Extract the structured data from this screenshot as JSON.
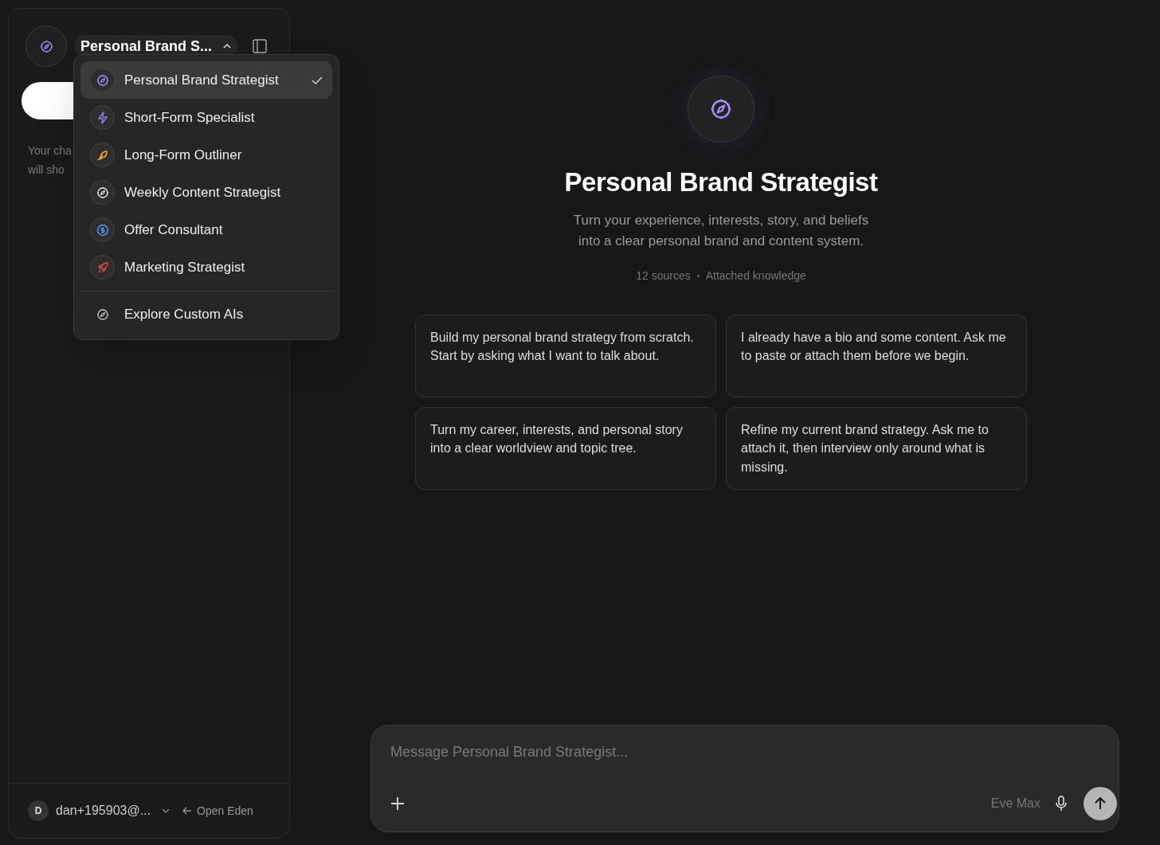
{
  "sidebar": {
    "assistant_button": {
      "title": "Personal Brand S...",
      "expanded": true
    },
    "empty_hint": [
      "Your cha",
      "will sho"
    ],
    "account": {
      "initial": "D",
      "email": "dan+195903@...",
      "action": "Open Eden"
    }
  },
  "assistant_menu": {
    "items": [
      {
        "label": "Personal Brand Strategist",
        "kind": "compass",
        "color": "#a98bfa",
        "selected": true
      },
      {
        "label": "Short-Form Specialist",
        "kind": "bolt",
        "color": "#9b7cf6",
        "selected": false
      },
      {
        "label": "Long-Form Outliner",
        "kind": "feather",
        "color": "#f5a524",
        "selected": false
      },
      {
        "label": "Weekly Content Strategist",
        "kind": "compass",
        "color": "#e5e5e5",
        "selected": false
      },
      {
        "label": "Offer Consultant",
        "kind": "dollar",
        "color": "#4f9cf5",
        "selected": false
      },
      {
        "label": "Marketing Strategist",
        "kind": "rocket",
        "color": "#e5484d",
        "selected": false
      }
    ],
    "footer": "Explore Custom AIs"
  },
  "hero": {
    "title": "Personal Brand Strategist",
    "subtitle": [
      "Turn your experience, interests, story, and beliefs",
      "into a clear personal brand and content system."
    ],
    "sources": "12 sources",
    "knowledge": "Attached knowledge"
  },
  "suggestions": [
    "Build my personal brand strategy from scratch. Start by asking what I want to talk about.",
    "I already have a bio and some content. Ask me to paste or attach them before we begin.",
    "Turn my career, interests, and personal story into a clear worldview and topic tree.",
    "Refine my current brand strategy. Ask me to attach it, then interview only around what is missing."
  ],
  "composer": {
    "placeholder": "Message Personal Brand Strategist...",
    "model": "Eve Max"
  }
}
